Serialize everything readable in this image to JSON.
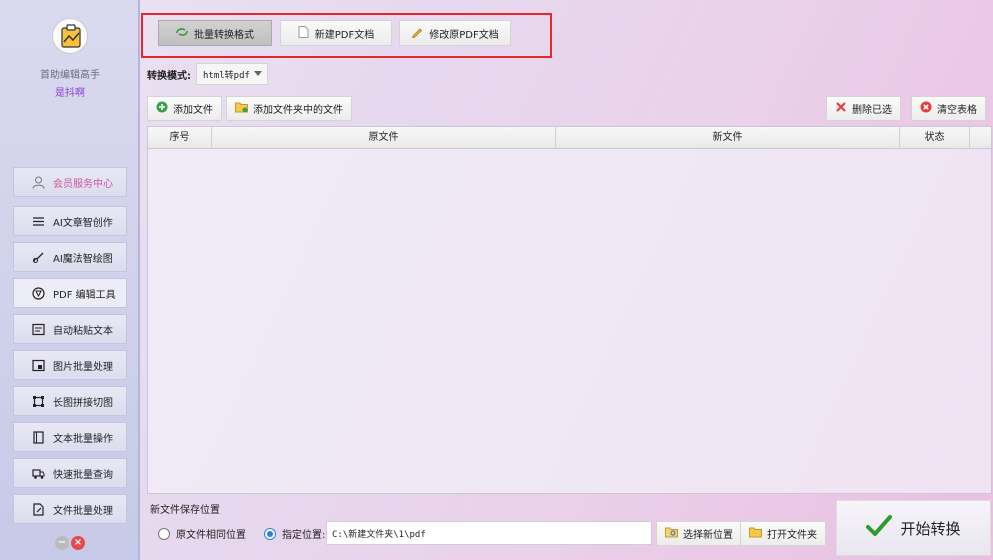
{
  "sidebar": {
    "app_name": "首助编辑高手",
    "user_name": "是抖啊",
    "items": [
      {
        "label": "会员服务中心",
        "icon": "user-icon"
      },
      {
        "label": "AI文章智创作",
        "icon": "lines-icon"
      },
      {
        "label": "AI魔法智绘图",
        "icon": "brush-icon"
      },
      {
        "label": "PDF 编辑工具",
        "icon": "aperture-icon"
      },
      {
        "label": "自动粘贴文本",
        "icon": "calendar-icon"
      },
      {
        "label": "图片批量处理",
        "icon": "image-icon"
      },
      {
        "label": "长图拼接切图",
        "icon": "crop-icon"
      },
      {
        "label": "文本批量操作",
        "icon": "book-icon"
      },
      {
        "label": "快速批量查询",
        "icon": "truck-icon"
      },
      {
        "label": "文件批量处理",
        "icon": "file-edit-icon"
      }
    ]
  },
  "tabs": [
    {
      "label": "批量转换格式",
      "icon": "convert-icon"
    },
    {
      "label": "新建PDF文档",
      "icon": "document-icon"
    },
    {
      "label": "修改原PDF文档",
      "icon": "pencil-icon"
    }
  ],
  "mode": {
    "label": "转换模式:",
    "value": "html转pdf"
  },
  "toolbar": {
    "add_file": "添加文件",
    "add_folder": "添加文件夹中的文件",
    "delete_selected": "删除已选",
    "clear_table": "清空表格"
  },
  "table": {
    "columns": [
      "序号",
      "原文件",
      "新文件",
      "状态"
    ],
    "rows": []
  },
  "save": {
    "section_label": "新文件保存位置",
    "option_same": "原文件相同位置",
    "option_custom": "指定位置:",
    "selected": "custom",
    "path": "C:\\新建文件夹\\1\\pdf",
    "choose_btn": "选择新位置",
    "open_btn": "打开文件夹"
  },
  "start_button": "开始转换",
  "colors": {
    "highlight_border": "#e4272e",
    "accent_user": "#8a3fd6",
    "radio_blue": "#2b7fd8"
  }
}
